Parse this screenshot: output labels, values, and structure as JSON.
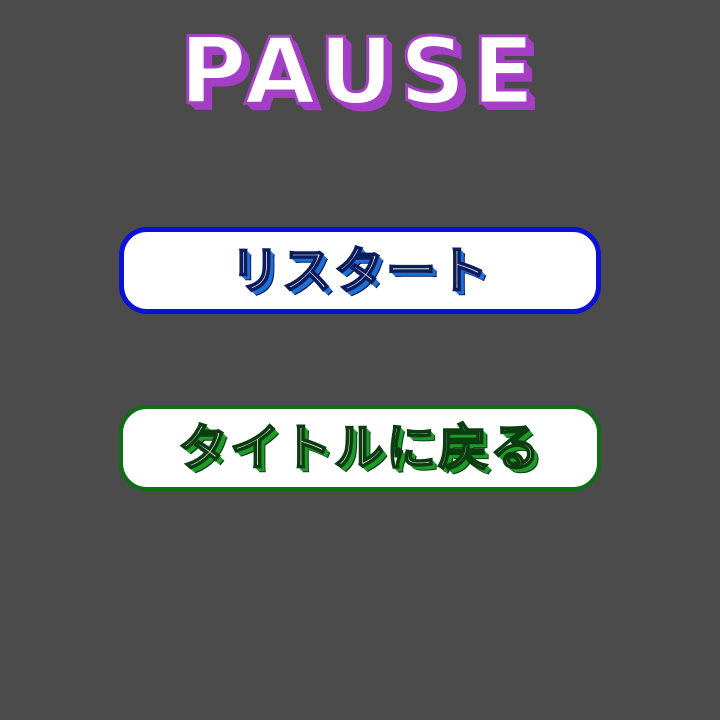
{
  "pause_menu": {
    "title": "PAUSE",
    "buttons": {
      "restart": {
        "label": "リスタート",
        "border_color": "#0a12d6",
        "text_color": "#1f6fd4"
      },
      "back_to_title": {
        "label": "タイトルに戻る",
        "border_color": "#0e6e16",
        "text_color": "#1f9a2a"
      }
    },
    "colors": {
      "background": "#4b4b4b",
      "title_accent": "#a53fc6",
      "button_fill": "#ffffff"
    }
  }
}
